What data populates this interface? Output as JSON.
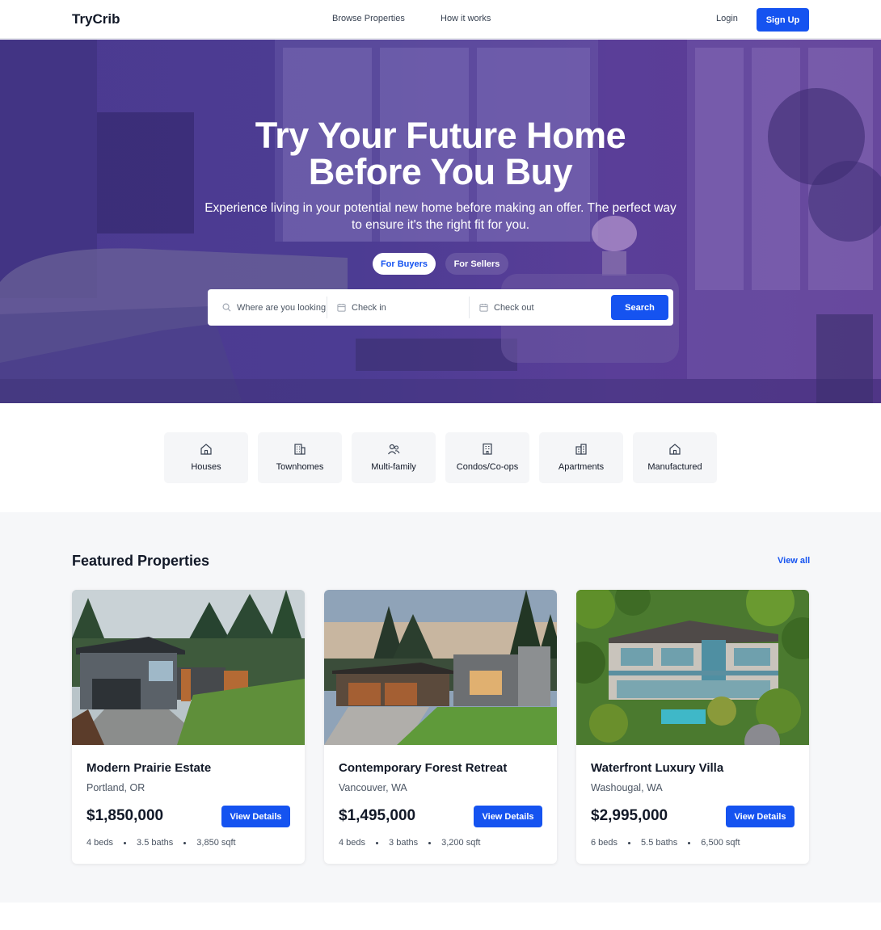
{
  "nav": {
    "brand": "TryCrib",
    "links": [
      "Browse Properties",
      "How it works"
    ],
    "login": "Login",
    "signup": "Sign Up"
  },
  "hero": {
    "title_line1": "Try Your Future Home",
    "title_line2": "Before You Buy",
    "subtitle": "Experience living in your potential new home before making an offer. The perfect way to ensure it's the right fit for you.",
    "tabs": [
      {
        "label": "For Buyers",
        "active": true
      },
      {
        "label": "For Sellers",
        "active": false
      }
    ],
    "search": {
      "location_placeholder": "Where are you looking?",
      "check_in_placeholder": "Check in",
      "check_out_placeholder": "Check out",
      "button": "Search"
    }
  },
  "categories": [
    {
      "label": "Houses",
      "icon": "house-icon"
    },
    {
      "label": "Townhomes",
      "icon": "townhome-icon"
    },
    {
      "label": "Multi-family",
      "icon": "multi-family-icon"
    },
    {
      "label": "Condos/Co-ops",
      "icon": "condo-icon"
    },
    {
      "label": "Apartments",
      "icon": "apartment-icon"
    },
    {
      "label": "Manufactured",
      "icon": "manufactured-home-icon"
    }
  ],
  "featured": {
    "title": "Featured Properties",
    "view_all": "View all",
    "properties": [
      {
        "name": "Modern Prairie Estate",
        "location": "Portland, OR",
        "price": "$1,850,000",
        "button": "View Details",
        "beds": "4 beds",
        "baths": "3.5 baths",
        "sqft": "3,850 sqft"
      },
      {
        "name": "Contemporary Forest Retreat",
        "location": "Vancouver, WA",
        "price": "$1,495,000",
        "button": "View Details",
        "beds": "4 beds",
        "baths": "3 baths",
        "sqft": "3,200 sqft"
      },
      {
        "name": "Waterfront Luxury Villa",
        "location": "Washougal, WA",
        "price": "$2,995,000",
        "button": "View Details",
        "beds": "6 beds",
        "baths": "5.5 baths",
        "sqft": "6,500 sqft"
      }
    ]
  },
  "colors": {
    "accent": "#1553f0",
    "hero_overlay": "#4c3c93",
    "section_bg": "#f6f7f9"
  }
}
